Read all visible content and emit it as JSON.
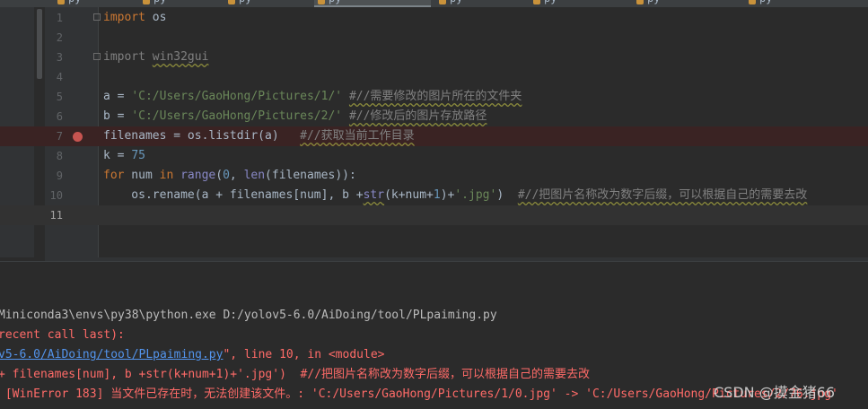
{
  "tabs": [
    {
      "label": "py"
    },
    {
      "label": "py"
    },
    {
      "label": "py"
    },
    {
      "label": "py"
    },
    {
      "label": "py",
      "active": true
    },
    {
      "label": "py"
    },
    {
      "label": "py"
    },
    {
      "label": "py"
    },
    {
      "label": "py"
    }
  ],
  "editor": {
    "lines": [
      {
        "num": "1",
        "code": "import os"
      },
      {
        "num": "2",
        "code": ""
      },
      {
        "num": "3",
        "code": "import win32gui"
      },
      {
        "num": "4",
        "code": ""
      },
      {
        "num": "5",
        "code": "a = 'C:/Users/GaoHong/Pictures/1/' #//需要修改的图片所在的文件夹"
      },
      {
        "num": "6",
        "code": "b = 'C:/Users/GaoHong/Pictures/2/' #//修改后的图片存放路径"
      },
      {
        "num": "7",
        "code": "filenames = os.listdir(a)   #//获取当前工作目录"
      },
      {
        "num": "8",
        "code": "k = 75"
      },
      {
        "num": "9",
        "code": "for num in range(0, len(filenames)):"
      },
      {
        "num": "10",
        "code": "    os.rename(a + filenames[num], b +str(k+num+1)+'.jpg')  #//把图片名称改为数字后缀，可以根据自己的需要去改"
      },
      {
        "num": "11",
        "code": ""
      }
    ],
    "breakpoint_line": "7"
  },
  "console": {
    "line1": "Miniconda3\\envs\\py38\\python.exe D:/yolov5-6.0/AiDoing/tool/PLpaiming.py",
    "line2": "recent call last):",
    "line3_link": "v5-6.0/AiDoing/tool/PLpaiming.py",
    "line3_rest": "\", line 10, in <module>",
    "line4": "+ filenames[num], b +str(k+num+1)+'.jpg')  #//把图片名称改为数字后缀，可以根据自己的需要去改",
    "line5": " [WinError 183] 当文件已存在时，无法创建该文件。: 'C:/Users/GaoHong/Pictures/1/0.jpg' -> 'C:/Users/GaoHong/Pictures/2/76.jpg'"
  },
  "watermark": "CSDN @摸金猪66",
  "colors": {
    "background": "#2b2b2b",
    "keyword": "#cc7832",
    "string": "#6a8759",
    "number": "#6897bb",
    "comment": "#808080",
    "error": "#ff6b68",
    "link": "#5394ec",
    "breakpoint": "#c75450"
  }
}
